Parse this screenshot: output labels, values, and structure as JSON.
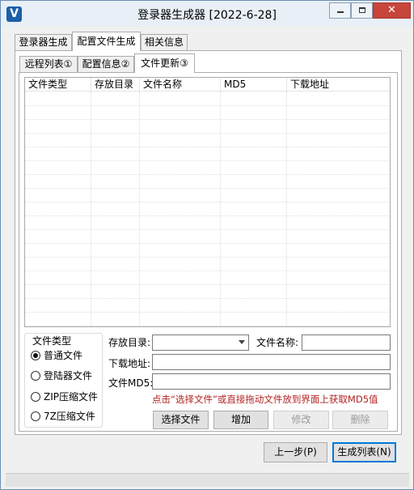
{
  "window": {
    "title": "登录器生成器 [2022-6-28]",
    "app_icon": "V",
    "min_symbol": "minimize-icon",
    "max_symbol": "maximize-icon",
    "close_symbol": "✕"
  },
  "outer_tabs": [
    {
      "label": "登录器生成"
    },
    {
      "label": "配置文件生成"
    },
    {
      "label": "相关信息"
    }
  ],
  "inner_tabs": [
    {
      "label": "远程列表①"
    },
    {
      "label": "配置信息②"
    },
    {
      "label": "文件更新③"
    }
  ],
  "list": {
    "columns": [
      "文件类型",
      "存放目录",
      "文件名称",
      "MD5",
      "下载地址"
    ],
    "rows": []
  },
  "file_type_group": {
    "label": "文件类型",
    "options": [
      {
        "label": "普通文件",
        "checked": true
      },
      {
        "label": "登陆器文件",
        "checked": false
      },
      {
        "label": "ZIP压缩文件",
        "checked": false
      },
      {
        "label": "7Z压缩文件",
        "checked": false
      }
    ]
  },
  "form": {
    "dir_label": "存放目录:",
    "dir_value": "",
    "name_label": "文件名称:",
    "name_value": "",
    "url_label": "下载地址:",
    "url_value": "",
    "md5_label": "文件MD5:",
    "md5_value": "",
    "hint": "点击“选择文件”或直接拖动文件放到界面上获取MD5值"
  },
  "buttons": {
    "select_file": "选择文件",
    "add": "增加",
    "modify": "修改",
    "delete": "删除",
    "prev": "上一步(P)",
    "generate": "生成列表(N)"
  },
  "colors": {
    "hint_red": "#b22222",
    "focus_blue": "#0078d7",
    "close_red": "#c7453b"
  }
}
